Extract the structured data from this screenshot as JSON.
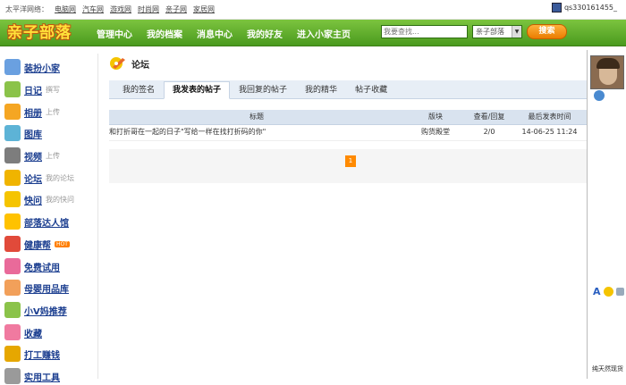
{
  "topbar": {
    "label": "太平洋网络：",
    "sites": [
      "电脑网",
      "汽车网",
      "游戏网",
      "时尚网",
      "亲子网",
      "家居网"
    ],
    "username": "qs330161455_"
  },
  "nav": {
    "logo": "亲子部落",
    "links": [
      "管理中心",
      "我的档案",
      "消息中心",
      "我的好友",
      "进入小家主页"
    ],
    "search_placeholder": "我要查找...",
    "search_scope": "亲子部落",
    "search_button": "搜索"
  },
  "sidebar": {
    "items": [
      {
        "label": "装扮小家",
        "sub": "",
        "icon": "paint-brush-icon",
        "color": "#6aa0e0"
      },
      {
        "label": "日记",
        "sub": "撰写",
        "icon": "diary-icon",
        "color": "#8bc34a"
      },
      {
        "label": "相册",
        "sub": "上传",
        "icon": "album-icon",
        "color": "#f5a623"
      },
      {
        "label": "图库",
        "sub": "",
        "icon": "gallery-icon",
        "color": "#5db3d6"
      },
      {
        "label": "视频",
        "sub": "上传",
        "icon": "video-icon",
        "color": "#7d7d7d"
      },
      {
        "label": "论坛",
        "sub": "我的论坛",
        "icon": "forum-icon",
        "color": "#f0b400"
      },
      {
        "label": "快问",
        "sub": "我的快问",
        "icon": "question-icon",
        "color": "#f5c400"
      },
      {
        "label": "部落达人馆",
        "sub": "",
        "icon": "star-icon",
        "color": "#ffc200"
      },
      {
        "label": "健康帮",
        "sub": "",
        "badge": "HOT",
        "icon": "magnet-icon",
        "color": "#e14a3a"
      },
      {
        "label": "免费试用",
        "sub": "",
        "icon": "gift-icon",
        "color": "#e96a9a"
      },
      {
        "label": "母婴用品库",
        "sub": "",
        "icon": "bow-icon",
        "color": "#f2a05a"
      },
      {
        "label": "小V妈推荐",
        "sub": "",
        "icon": "book-icon",
        "color": "#8bc34a"
      },
      {
        "label": "收藏",
        "sub": "",
        "icon": "eraser-icon",
        "color": "#f07aa0"
      },
      {
        "label": "打工赚钱",
        "sub": "",
        "icon": "coin-bag-icon",
        "color": "#e6a700"
      },
      {
        "label": "实用工具",
        "sub": "",
        "icon": "tools-icon",
        "color": "#9a9a9a"
      }
    ]
  },
  "main": {
    "title": "论坛",
    "tabs": [
      "我的签名",
      "我发表的帖子",
      "我回复的帖子",
      "我的精华",
      "帖子收藏"
    ],
    "active_tab": "我发表的帖子",
    "columns": [
      "标题",
      "版块",
      "查看/回复",
      "最后发表时间"
    ],
    "rows": [
      {
        "title": "和打折哥在一起的日子\"写给一样在找打折码的你\"",
        "board": "购货殿堂",
        "views": "2/0",
        "time": "14-06-25 11:24"
      }
    ],
    "page": "1"
  },
  "chat": {
    "bottom_text": "纯天然现货"
  }
}
